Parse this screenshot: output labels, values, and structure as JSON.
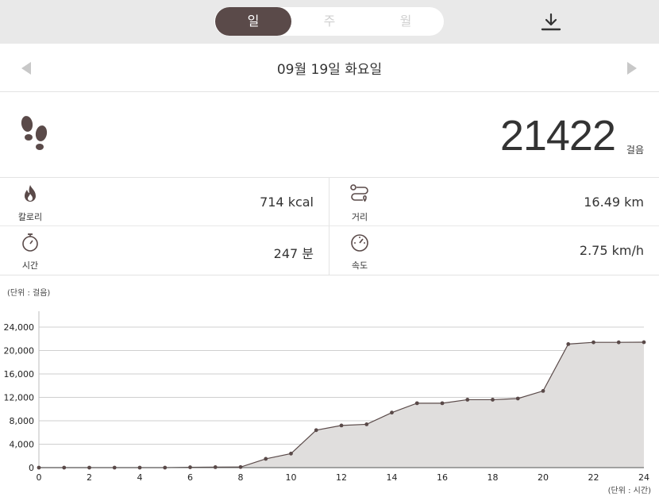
{
  "tabs": [
    {
      "label": "일",
      "active": true
    },
    {
      "label": "주",
      "active": false
    },
    {
      "label": "월",
      "active": false
    }
  ],
  "icons": {
    "download": "download-icon",
    "prev": "chevron-left-icon",
    "next": "chevron-right-icon",
    "steps": "footprints-icon",
    "calorie": "flame-icon",
    "distance": "route-icon",
    "time": "stopwatch-icon",
    "speed": "speedometer-icon"
  },
  "date": "09월 19일 화요일",
  "steps": {
    "value": "21422",
    "unit": "걸음"
  },
  "stats": {
    "calorie": {
      "label": "칼로리",
      "value": "714 kcal"
    },
    "distance": {
      "label": "거리",
      "value": "16.49 km"
    },
    "time": {
      "label": "시간",
      "value": "247 분"
    },
    "speed": {
      "label": "속도",
      "value": "2.75 km/h"
    }
  },
  "colors": {
    "accent": "#5a4a49",
    "line": "#5a4a49",
    "area": "#e0dedd",
    "grid": "#cfcfcf"
  },
  "chart_data": {
    "type": "area",
    "y_unit_label": "(단위 : 걸음)",
    "x_unit_label": "(단위 : 시간)",
    "x": [
      0,
      1,
      2,
      3,
      4,
      5,
      6,
      7,
      8,
      9,
      10,
      11,
      12,
      13,
      14,
      15,
      16,
      17,
      18,
      19,
      20,
      21,
      22,
      23,
      24
    ],
    "values": [
      0,
      0,
      0,
      0,
      0,
      0,
      60,
      80,
      100,
      1500,
      2400,
      6400,
      7200,
      7400,
      9400,
      11000,
      11000,
      11600,
      11600,
      11800,
      13100,
      21100,
      21400,
      21400,
      21422
    ],
    "xlim": [
      0,
      24
    ],
    "ylim": [
      0,
      24000
    ],
    "x_ticks": [
      0,
      2,
      4,
      6,
      8,
      10,
      12,
      14,
      16,
      18,
      20,
      22,
      24
    ],
    "y_ticks": [
      0,
      4000,
      8000,
      12000,
      16000,
      20000,
      24000
    ],
    "y_tick_labels": [
      "0",
      "4,000",
      "8,000",
      "12,000",
      "16,000",
      "20,000",
      "24,000"
    ],
    "grid": true
  }
}
